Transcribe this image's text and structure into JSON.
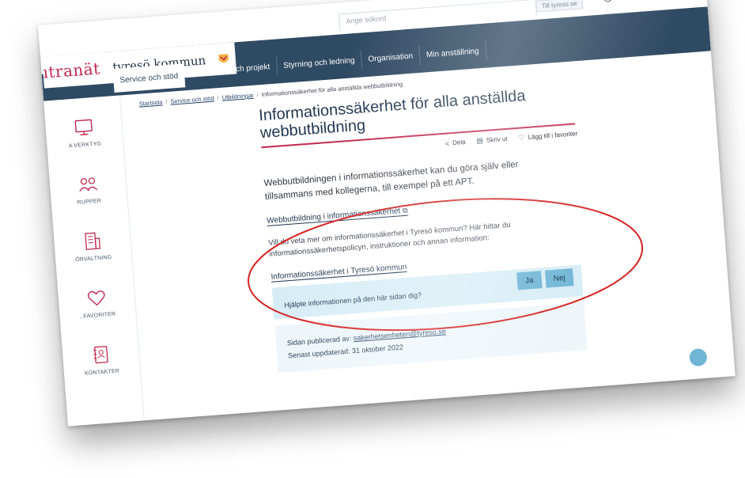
{
  "top": {
    "search_placeholder": "Ange sökord",
    "external_link": "Till tyreso.se",
    "icons": [
      "help-icon",
      "bell-icon",
      "settings-icon",
      "leaf-icon"
    ]
  },
  "brand": {
    "logo": "ıtranät",
    "municipality": "tyresö kommun"
  },
  "nav": {
    "tabs": [
      {
        "label": "Service och stöd",
        "active": true
      },
      {
        "label": "Samarbete och projekt"
      },
      {
        "label": "Styrning och ledning"
      },
      {
        "label": "Organisation"
      },
      {
        "label": "Min anställning"
      }
    ]
  },
  "breadcrumb": {
    "items": [
      "Startsida",
      "Service och stöd",
      "Utbildningar"
    ],
    "current": "Informationssäkerhet för alla anställda webbutbildning",
    "separator": "/"
  },
  "rail": {
    "items": [
      {
        "label": "A VERKTYG",
        "icon": "monitor-icon"
      },
      {
        "label": "RUPPER",
        "icon": "groups-icon"
      },
      {
        "label": "ÖRVALTNING",
        "icon": "building-icon"
      },
      {
        "label": ", FAVORITER",
        "icon": "heart-icon"
      },
      {
        "label": "KONTAKTER",
        "icon": "contacts-icon"
      }
    ]
  },
  "main": {
    "title_line1": "Informationssäkerhet för alla anställda",
    "title_line2": "webbutbildning",
    "actions": {
      "share": "Dela",
      "print": "Skriv ut",
      "favorite": "Lägg till i favoriter"
    },
    "intro": "Webbutbildningen i informationssäkerhet kan du göra själv eller tillsammans med kollegerna, till exempel på ett APT.",
    "course_link": "Webbutbildning i informationssäkerhet",
    "description": "Vill du veta mer om informationssäkerhet i Tyresö kommun? Här hittar du informationssäkerhetspolicyn, instruktioner och annan information:",
    "infosec_link": "Informationssäkerhet i Tyresö kommun",
    "feedback": {
      "question": "Hjälpte informationen på den här sidan dig?",
      "yes": "Ja",
      "no": "Nej"
    },
    "published_by_label": "Sidan publicerad av:",
    "published_by": "sakerhetsenheten@tyreso.se",
    "updated_label": "Senast uppdaterad:",
    "updated": "31 oktober 2022"
  },
  "colors": {
    "nav": "#2f4a63",
    "accent": "#c0294e",
    "feedback_bg": "#d7edf6",
    "button": "#6fb5d6",
    "annotation": "#d42020"
  }
}
